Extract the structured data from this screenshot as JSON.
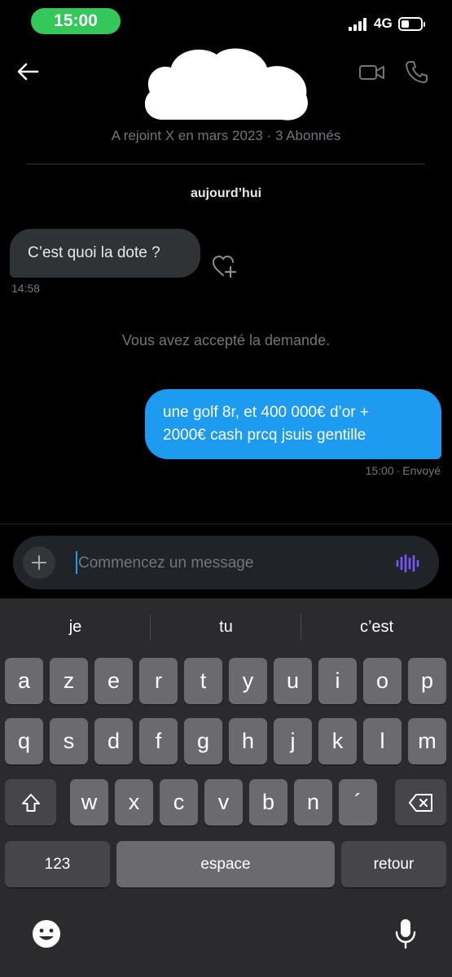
{
  "status_bar": {
    "time": "15:00",
    "network": "4G"
  },
  "header": {
    "profile_meta": "A rejoint X en mars 2023 · 3 Abonnés"
  },
  "conversation": {
    "date_separator": "aujourd’hui",
    "incoming": {
      "text": "C’est quoi la dote ?",
      "time": "14:58"
    },
    "system_note": "Vous avez accepté la demande.",
    "outgoing": {
      "lines": [
        "une golf 8r, et 400 000€ d’or +",
        "2000€ cash prcq jsuis gentille"
      ],
      "time": "15:00",
      "status": "Envoyé"
    }
  },
  "composer": {
    "placeholder": "Commencez un message"
  },
  "keyboard": {
    "suggestions": [
      "je",
      "tu",
      "c’est"
    ],
    "row1": [
      "a",
      "z",
      "e",
      "r",
      "t",
      "y",
      "u",
      "i",
      "o",
      "p"
    ],
    "row2": [
      "q",
      "s",
      "d",
      "f",
      "g",
      "h",
      "j",
      "k",
      "l",
      "m"
    ],
    "row3": [
      "w",
      "x",
      "c",
      "v",
      "b",
      "n",
      "´"
    ],
    "numbers_key": "123",
    "space_key": "espace",
    "return_key": "retour"
  },
  "colors": {
    "accent": "#1d9bf0",
    "bubble_in": "#2f3336",
    "status_pill": "#34c759",
    "voice_icon": "#7856ff"
  },
  "icons": [
    "back-arrow-icon",
    "video-call-icon",
    "phone-icon",
    "heart-plus-icon",
    "plus-icon",
    "voice-wave-icon",
    "shift-icon",
    "backspace-icon",
    "emoji-icon",
    "microphone-icon"
  ]
}
